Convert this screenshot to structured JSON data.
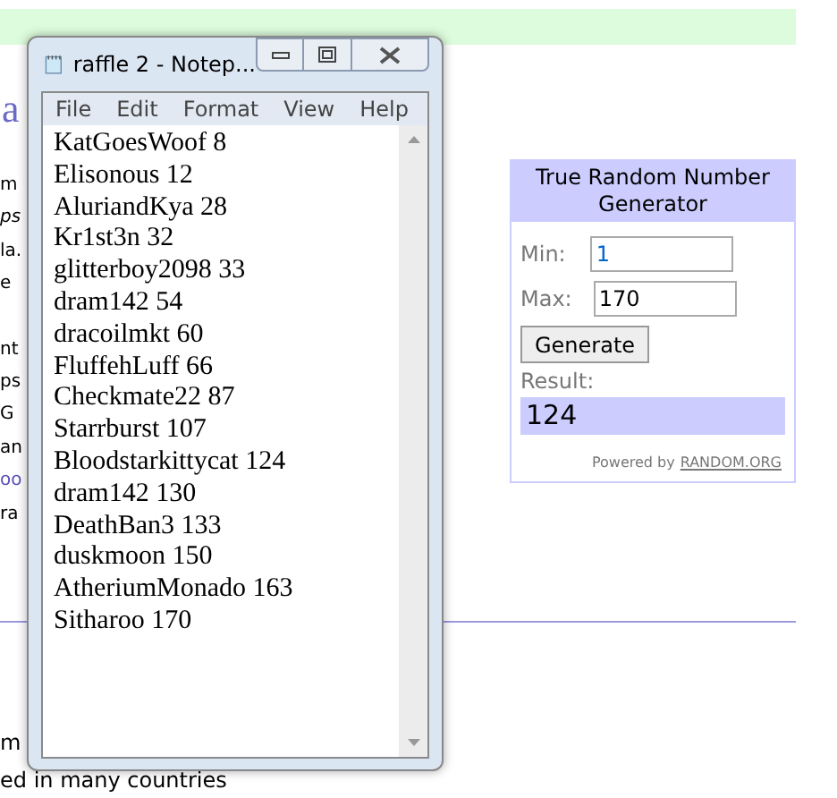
{
  "background_page": {
    "heading_fragment": "a",
    "fragments": [
      {
        "text": "m",
        "kind": "plain"
      },
      {
        "text": "ps",
        "kind": "italic"
      },
      {
        "text": "la.",
        "kind": "plain"
      },
      {
        "text": "e",
        "kind": "plain"
      },
      {
        "text": "nt",
        "kind": "plain"
      },
      {
        "text": "ps",
        "kind": "plain"
      },
      {
        "text": "G",
        "kind": "plain"
      },
      {
        "text": "an",
        "kind": "plain"
      },
      {
        "text": "oo",
        "kind": "link"
      },
      {
        "text": "ra",
        "kind": "plain"
      }
    ],
    "lower_fragments": [
      "m",
      "ed in many countries"
    ]
  },
  "notepad": {
    "title": "raffle 2 - Notep...",
    "menu": [
      "File",
      "Edit",
      "Format",
      "View",
      "Help"
    ],
    "lines": [
      "KatGoesWoof 8",
      "Elisonous 12",
      "AluriandKya 28",
      "Kr1st3n 32",
      "glitterboy2098 33",
      "dram142 54",
      "dracoilmkt 60",
      "FluffehLuff 66",
      "Checkmate22 87",
      "Starrburst 107",
      "Bloodstarkittycat 124",
      "dram142 130",
      "DeathBan3 133",
      "duskmoon 150",
      "AtheriumMonado 163",
      "Sitharoo 170"
    ]
  },
  "widget": {
    "title": "True Random Number Generator",
    "min_label": "Min:",
    "min_value": "1",
    "max_label": "Max:",
    "max_value": "170",
    "button": "Generate",
    "result_label": "Result:",
    "result": "124",
    "powered_by": "Powered by",
    "powered_link": "RANDOM.ORG"
  }
}
